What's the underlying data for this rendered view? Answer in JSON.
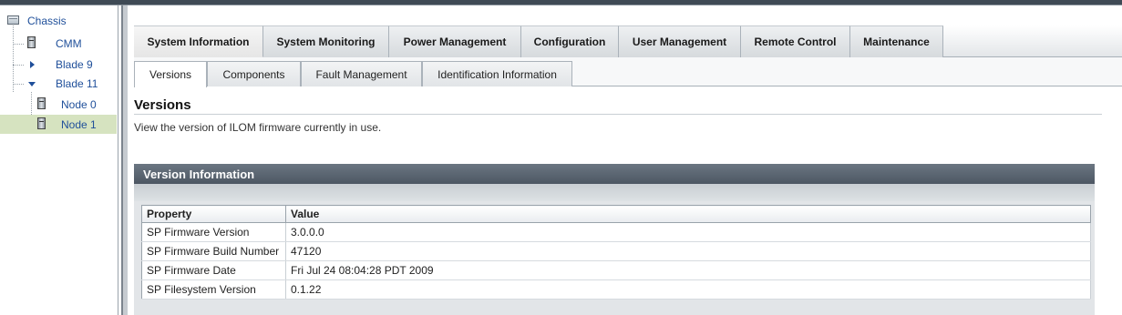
{
  "tree": {
    "items": [
      {
        "label": "Chassis"
      },
      {
        "label": "CMM"
      },
      {
        "label": "Blade 9"
      },
      {
        "label": "Blade 11"
      },
      {
        "label": "Node 0"
      },
      {
        "label": "Node 1"
      }
    ],
    "selected": "Node 1"
  },
  "main_tabs": [
    {
      "label": "System Information"
    },
    {
      "label": "System Monitoring"
    },
    {
      "label": "Power Management"
    },
    {
      "label": "Configuration"
    },
    {
      "label": "User Management"
    },
    {
      "label": "Remote Control"
    },
    {
      "label": "Maintenance"
    }
  ],
  "sub_tabs": [
    {
      "label": "Versions"
    },
    {
      "label": "Components"
    },
    {
      "label": "Fault Management"
    },
    {
      "label": "Identification Information"
    }
  ],
  "page": {
    "title": "Versions",
    "description": "View the version of ILOM firmware currently in use."
  },
  "panel": {
    "title": "Version Information",
    "columns": [
      "Property",
      "Value"
    ],
    "rows": [
      {
        "property": "SP Firmware Version",
        "value": "3.0.0.0"
      },
      {
        "property": "SP Firmware Build Number",
        "value": "47120"
      },
      {
        "property": "SP Firmware Date",
        "value": "Fri Jul 24 08:04:28 PDT 2009"
      },
      {
        "property": "SP Filesystem Version",
        "value": "0.1.22"
      }
    ]
  },
  "colors": {
    "selection": "#d6e3c0",
    "link": "#1f4f9a",
    "panel_header": "#5a6470"
  }
}
